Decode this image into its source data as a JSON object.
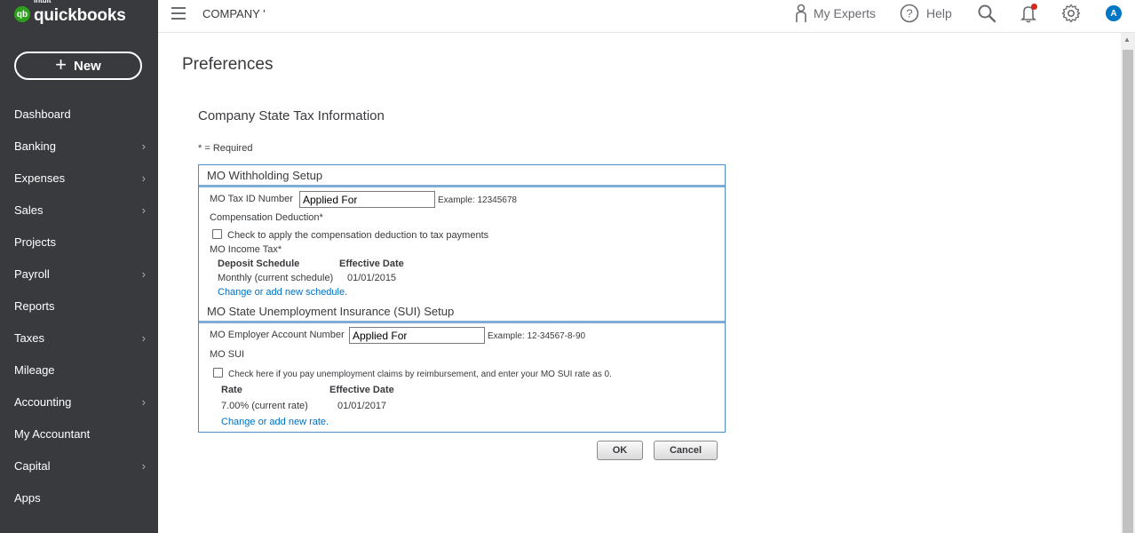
{
  "brand": {
    "intuit": "intuit",
    "name": "quickbooks",
    "mark": "qb"
  },
  "new_button": {
    "label": "New"
  },
  "sidebar": {
    "items": [
      {
        "label": "Dashboard",
        "chevron": false
      },
      {
        "label": "Banking",
        "chevron": true
      },
      {
        "label": "Expenses",
        "chevron": true
      },
      {
        "label": "Sales",
        "chevron": true
      },
      {
        "label": "Projects",
        "chevron": false
      },
      {
        "label": "Payroll",
        "chevron": true
      },
      {
        "label": "Reports",
        "chevron": false
      },
      {
        "label": "Taxes",
        "chevron": true
      },
      {
        "label": "Mileage",
        "chevron": false
      },
      {
        "label": "Accounting",
        "chevron": true
      },
      {
        "label": "My Accountant",
        "chevron": false
      },
      {
        "label": "Capital",
        "chevron": true
      },
      {
        "label": "Apps",
        "chevron": false
      }
    ]
  },
  "header": {
    "company": "COMPANY '",
    "my_experts": "My Experts",
    "help": "Help",
    "avatar_initial": "A",
    "notification_dot_color": "#d52b1e"
  },
  "main": {
    "page_title": "Preferences",
    "section_title": "Company State Tax Information",
    "required_note": "* = Required"
  },
  "withholding": {
    "heading": "MO Withholding Setup",
    "tax_id_label": "MO Tax ID Number",
    "tax_id_value": "Applied For",
    "tax_id_example": "Example: 12345678",
    "comp_deduction_label": "Compensation Deduction*",
    "comp_deduction_checkbox": "Check to apply the compensation deduction to tax payments",
    "income_tax_label": "MO Income Tax*",
    "col_schedule": "Deposit Schedule",
    "col_effective": "Effective Date",
    "schedule_value": "Monthly (current schedule)",
    "schedule_date": "01/01/2015",
    "change_link": "Change or add new schedule."
  },
  "sui": {
    "heading": "MO State Unemployment Insurance (SUI) Setup",
    "account_label": "MO Employer Account Number",
    "account_value": "Applied For",
    "account_example": "Example: 12-34567-8-90",
    "sui_label": "MO SUI",
    "reimbursement_checkbox": "Check here if you pay unemployment claims by reimbursement, and enter your MO SUI rate as 0.",
    "col_rate": "Rate",
    "col_effective": "Effective Date",
    "rate_value": "7.00% (current rate)",
    "rate_date": "01/01/2017",
    "change_link": "Change or add new rate."
  },
  "buttons": {
    "ok": "OK",
    "cancel": "Cancel"
  }
}
